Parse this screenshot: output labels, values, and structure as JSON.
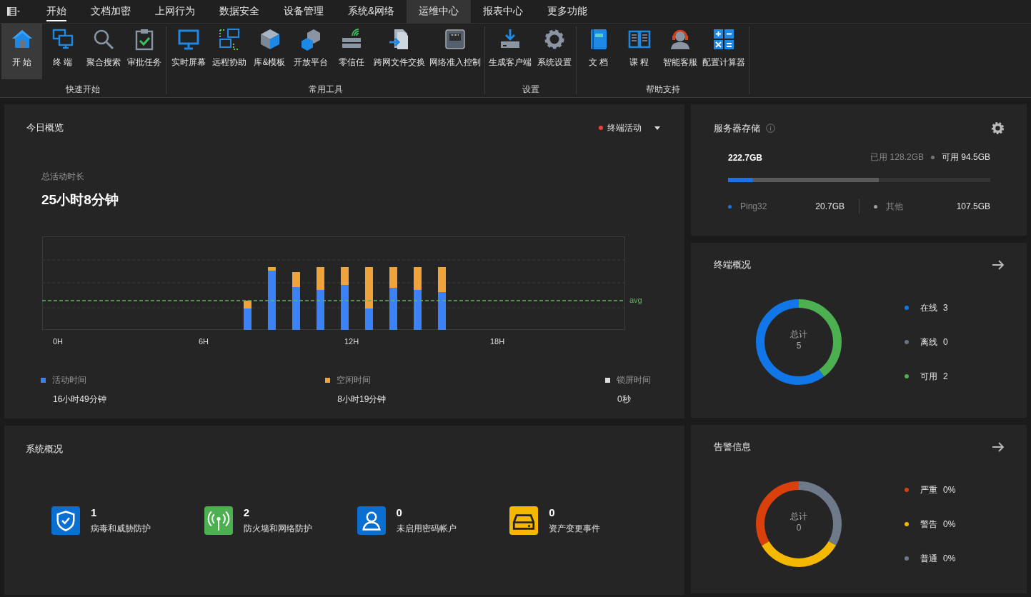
{
  "menu_tabs": [
    {
      "label": "开始",
      "selected": true,
      "hovered": false
    },
    {
      "label": "文档加密",
      "selected": false,
      "hovered": false
    },
    {
      "label": "上网行为",
      "selected": false,
      "hovered": false
    },
    {
      "label": "数据安全",
      "selected": false,
      "hovered": false
    },
    {
      "label": "设备管理",
      "selected": false,
      "hovered": false
    },
    {
      "label": "系统&网络",
      "selected": false,
      "hovered": false
    },
    {
      "label": "运维中心",
      "selected": false,
      "hovered": true
    },
    {
      "label": "报表中心",
      "selected": false,
      "hovered": false
    },
    {
      "label": "更多功能",
      "selected": false,
      "hovered": false
    }
  ],
  "ribbon": {
    "groups": [
      {
        "label": "快速开始",
        "items": [
          {
            "label": "开 始",
            "selected": true
          },
          {
            "label": "终 端",
            "selected": false
          },
          {
            "label": "聚合搜索",
            "selected": false
          },
          {
            "label": "审批任务",
            "selected": false
          }
        ]
      },
      {
        "label": "常用工具",
        "items": [
          {
            "label": "实时屏幕",
            "selected": false
          },
          {
            "label": "远程协助",
            "selected": false
          },
          {
            "label": "库&模板",
            "selected": false
          },
          {
            "label": "开放平台",
            "selected": false
          },
          {
            "label": "零信任",
            "selected": false
          },
          {
            "label": "跨网文件交换",
            "selected": false
          },
          {
            "label": "网络准入控制",
            "selected": false
          }
        ]
      },
      {
        "label": "设置",
        "items": [
          {
            "label": "生成客户端",
            "selected": false
          },
          {
            "label": "系统设置",
            "selected": false
          }
        ]
      },
      {
        "label": "帮助支持",
        "items": [
          {
            "label": "文 档",
            "selected": false
          },
          {
            "label": "课 程",
            "selected": false
          },
          {
            "label": "智能客服",
            "selected": false
          },
          {
            "label": "配置计算器",
            "selected": false
          }
        ]
      }
    ]
  },
  "today_overview": {
    "title": "今日概览",
    "filter": {
      "label": "终端活动",
      "color": "#e8453c"
    },
    "total_label": "总活动时长",
    "total_value": "25小时8分钟",
    "x_labels": [
      "0H",
      "6H",
      "12H",
      "18H"
    ],
    "avg_label": "avg",
    "legend": [
      {
        "label": "活动时间",
        "value": "16小时49分钟",
        "color": "#3b82f6"
      },
      {
        "label": "空闲时间",
        "value": "8小时19分钟",
        "color": "#f0a23b"
      },
      {
        "label": "锁屏时间",
        "value": "0秒",
        "color": "#dddddd"
      }
    ]
  },
  "system_overview": {
    "title": "系统概况",
    "items": [
      {
        "count": "1",
        "label": "病毒和威胁防护",
        "color": "#0a6fd1"
      },
      {
        "count": "2",
        "label": "防火墙和网络防护",
        "color": "#4caf50"
      },
      {
        "count": "0",
        "label": "未启用密码帐户",
        "color": "#0a6fd1"
      },
      {
        "count": "0",
        "label": "资产变更事件",
        "color": "#f5b800"
      }
    ]
  },
  "server_storage": {
    "title": "服务器存储",
    "total": "222.7GB",
    "used_label": "已用",
    "used_value": "128.2GB",
    "free_label": "可用",
    "free_value": "94.5GB",
    "usage_bar": [
      {
        "level": 0.576,
        "color": "#5a5a5a"
      },
      {
        "level": 0.093,
        "color": "#1a73e8"
      }
    ],
    "breakdown": [
      {
        "label": "Ping32",
        "value": "20.7GB",
        "color": "#1a73e8"
      },
      {
        "label": "其他",
        "value": "107.5GB",
        "color": "#9aa0a6"
      }
    ]
  },
  "terminal_overview": {
    "title": "终端概况",
    "center_label": "总计",
    "center_value": "5",
    "legend": [
      {
        "label": "在线",
        "value": "3",
        "color": "#1177e8"
      },
      {
        "label": "离线",
        "value": "0",
        "color": "#6b7280"
      },
      {
        "label": "可用",
        "value": "2",
        "color": "#4caf50"
      }
    ]
  },
  "alert_info": {
    "title": "告警信息",
    "center_label": "总计",
    "center_value": "0",
    "legend": [
      {
        "label": "严重",
        "value": "0%",
        "color": "#d9400c"
      },
      {
        "label": "警告",
        "value": "0%",
        "color": "#f5b800"
      },
      {
        "label": "普通",
        "value": "0%",
        "color": "#6e7a8a"
      }
    ]
  }
}
